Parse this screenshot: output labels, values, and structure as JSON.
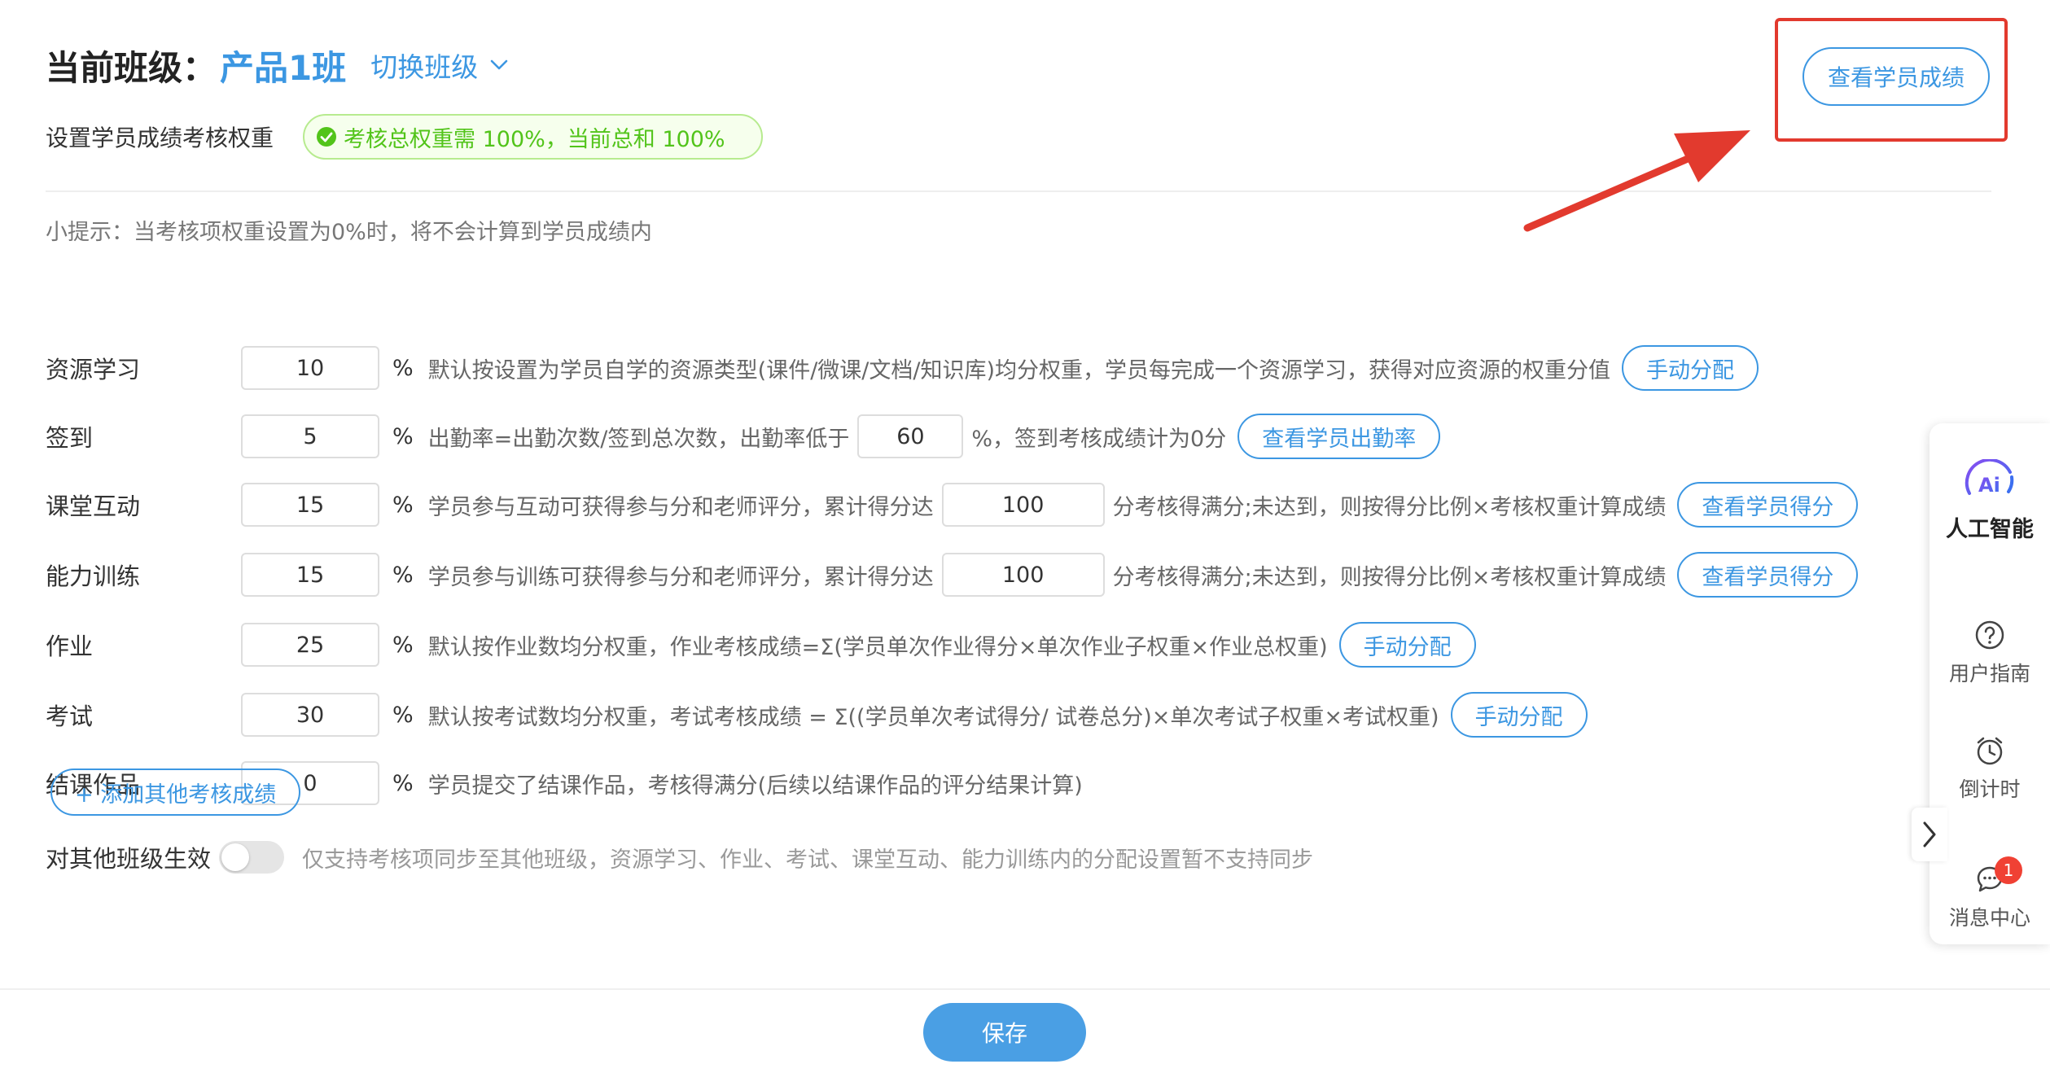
{
  "header": {
    "title_label": "当前班级：",
    "class_name": "产品1班",
    "switch_label": "切换班级",
    "scores_button": "查看学员成绩"
  },
  "weight": {
    "label": "设置学员成绩考核权重",
    "badge": "考核总权重需 100%，当前总和 100%"
  },
  "tip": "小提示：当考核项权重设置为0%时，将不会计算到学员成绩内",
  "percent_sign": "%",
  "rows": {
    "resource": {
      "label": "资源学习",
      "value": "10",
      "desc": "默认按设置为学员自学的资源类型(课件/微课/文档/知识库)均分权重，学员每完成一个资源学习，获得对应资源的权重分值",
      "button": "手动分配"
    },
    "checkin": {
      "label": "签到",
      "value": "5",
      "desc_before": "出勤率=出勤次数/签到总次数，出勤率低于",
      "threshold": "60",
      "desc_after": "%，签到考核成绩计为0分",
      "button": "查看学员出勤率"
    },
    "interaction": {
      "label": "课堂互动",
      "value": "15",
      "desc_before": "学员参与互动可获得参与分和老师评分，累计得分达",
      "threshold": "100",
      "desc_after": "分考核得满分;未达到，则按得分比例×考核权重计算成绩",
      "button": "查看学员得分"
    },
    "training": {
      "label": "能力训练",
      "value": "15",
      "desc_before": "学员参与训练可获得参与分和老师评分，累计得分达",
      "threshold": "100",
      "desc_after": "分考核得满分;未达到，则按得分比例×考核权重计算成绩",
      "button": "查看学员得分"
    },
    "homework": {
      "label": "作业",
      "value": "25",
      "desc": "默认按作业数均分权重，作业考核成绩=Σ(学员单次作业得分×单次作业子权重×作业总权重)",
      "button": "手动分配"
    },
    "exam": {
      "label": "考试",
      "value": "30",
      "desc": "默认按考试数均分权重，考试考核成绩 = Σ((学员单次考试得分/ 试卷总分)×单次考试子权重×考试权重)",
      "button": "手动分配"
    },
    "final": {
      "label": "结课作品",
      "value": "0",
      "desc": "学员提交了结课作品，考核得满分(后续以结课作品的评分结果计算)"
    }
  },
  "add_button": "+ 添加其他考核成绩",
  "sync": {
    "label": "对其他班级生效",
    "enabled": false,
    "note": "仅支持考核项同步至其他班级，资源学习、作业、考试、课堂互动、能力训练内的分配设置暂不支持同步"
  },
  "save_button": "保存",
  "sidebar": {
    "ai_mark": "Ai",
    "ai_label": "人工智能",
    "guide_label": "用户指南",
    "timer_label": "倒计时",
    "message_label": "消息中心",
    "message_count": "1"
  },
  "colors": {
    "primary": "#3c97e2",
    "success": "#52c41a",
    "annotation": "#e23a2e",
    "badge": "#f04134"
  },
  "icons": {
    "switch": "chevron-down-icon",
    "badge": "check-circle-icon",
    "ai": "ai-icon",
    "guide": "question-circle-icon",
    "timer": "alarm-clock-icon",
    "message": "chat-bubble-icon",
    "collapse": "chevron-right-icon"
  }
}
